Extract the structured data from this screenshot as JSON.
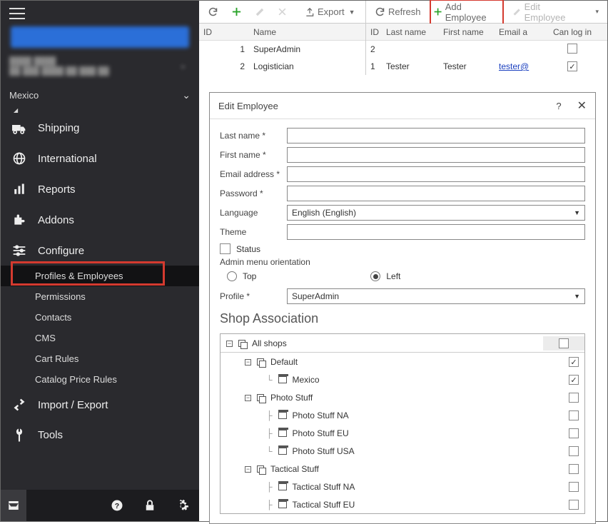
{
  "sidebar": {
    "country": "Mexico",
    "items": [
      {
        "label": "Shipping"
      },
      {
        "label": "International"
      },
      {
        "label": "Reports"
      },
      {
        "label": "Addons"
      },
      {
        "label": "Configure"
      }
    ],
    "sub_items": [
      {
        "label": "Profiles & Employees"
      },
      {
        "label": "Permissions"
      },
      {
        "label": "Contacts"
      },
      {
        "label": "CMS"
      },
      {
        "label": "Cart Rules"
      },
      {
        "label": "Catalog Price Rules"
      }
    ],
    "tail_items": [
      {
        "label": "Import / Export"
      },
      {
        "label": "Tools"
      }
    ]
  },
  "toolbar": {
    "export": "Export",
    "refresh": "Refresh",
    "add_employee": "Add Employee",
    "edit_employee": "Edit Employee"
  },
  "grid_left": {
    "cols": [
      "ID",
      "Name"
    ],
    "rows": [
      {
        "id": "1",
        "name": "SuperAdmin"
      },
      {
        "id": "2",
        "name": "Logistician"
      }
    ]
  },
  "grid_right": {
    "cols": [
      "ID",
      "Last name",
      "First name",
      "Email a",
      "Can log in"
    ],
    "rows": [
      {
        "id": "2",
        "last": "",
        "first": "",
        "email": "",
        "login": false
      },
      {
        "id": "1",
        "last": "Tester",
        "first": "Tester",
        "email": "tester@",
        "login": true
      }
    ]
  },
  "panel": {
    "title": "Edit Employee",
    "help": "?",
    "fields": {
      "last_name": "Last name *",
      "first_name": "First name *",
      "email": "Email address *",
      "password": "Password *",
      "language": "Language",
      "language_val": "English (English)",
      "theme": "Theme",
      "status": "Status",
      "orientation": "Admin menu orientation",
      "top": "Top",
      "left": "Left",
      "profile": "Profile *",
      "profile_val": "SuperAdmin"
    },
    "shop_title": "Shop Association",
    "tree": [
      {
        "label": "All shops",
        "level": 0,
        "checked": false,
        "icon": "grp"
      },
      {
        "label": "Default",
        "level": 1,
        "checked": true,
        "icon": "grp"
      },
      {
        "label": "Mexico",
        "level": 2,
        "checked": true,
        "icon": "shop"
      },
      {
        "label": "Photo Stuff",
        "level": 1,
        "checked": false,
        "icon": "grp"
      },
      {
        "label": "Photo Stuff NA",
        "level": 2,
        "checked": false,
        "icon": "shop"
      },
      {
        "label": "Photo Stuff EU",
        "level": 2,
        "checked": false,
        "icon": "shop"
      },
      {
        "label": "Photo Stuff USA",
        "level": 2,
        "checked": false,
        "icon": "shop"
      },
      {
        "label": "Tactical Stuff",
        "level": 1,
        "checked": false,
        "icon": "grp"
      },
      {
        "label": "Tactical Stuff NA",
        "level": 2,
        "checked": false,
        "icon": "shop"
      },
      {
        "label": "Tactical Stuff EU",
        "level": 2,
        "checked": false,
        "icon": "shop"
      }
    ]
  }
}
